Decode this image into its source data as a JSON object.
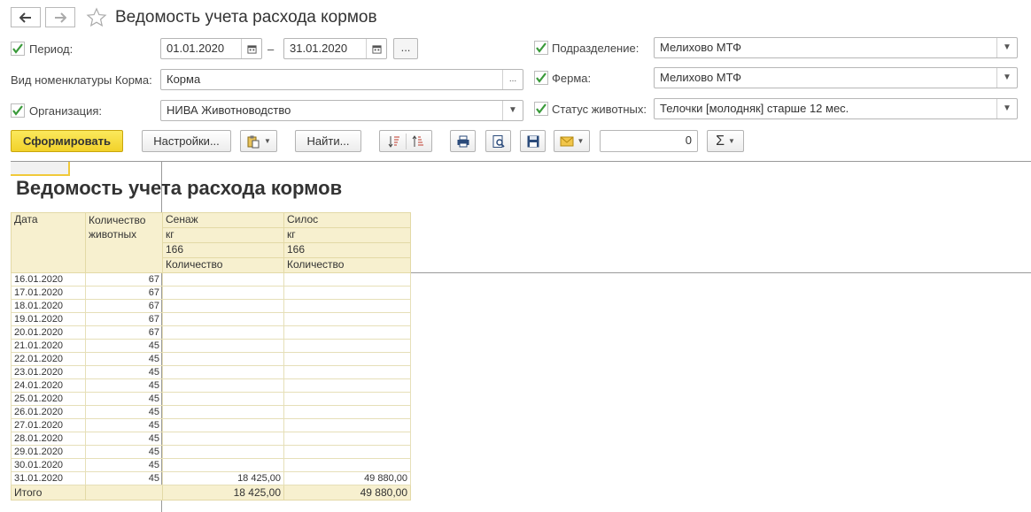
{
  "header": {
    "title": "Ведомость учета расхода кормов"
  },
  "form": {
    "period_label": "Период:",
    "period_from": "01.01.2020",
    "period_dash": "–",
    "period_to": "31.01.2020",
    "dots": "...",
    "nomenclature_label": "Вид номенклатуры Корма:",
    "nomenclature_value": "Корма",
    "org_label": "Организация:",
    "org_value": "НИВА Животноводство",
    "division_label": "Подразделение:",
    "division_value": "Мелихово МТФ",
    "farm_label": "Ферма:",
    "farm_value": "Мелихово МТФ",
    "status_label": "Статус животных:",
    "status_value": "Телочки [молодняк] старше 12 мес."
  },
  "toolbar": {
    "generate": "Сформировать",
    "settings": "Настройки...",
    "find": "Найти...",
    "amount_value": "0",
    "sum_symbol": "Σ"
  },
  "report": {
    "title": "Ведомость учета расхода кормов",
    "col_date": "Дата",
    "col_count": "Количество животных",
    "col_senazh": "Сенаж",
    "col_silos": "Силос",
    "unit_senazh": "кг",
    "unit_silos": "кг",
    "code_senazh": "166",
    "code_silos": "166",
    "qty_senazh": "Количество",
    "qty_silos": "Количество",
    "rows": [
      {
        "date": "16.01.2020",
        "count": "67",
        "senazh": "",
        "silos": ""
      },
      {
        "date": "17.01.2020",
        "count": "67",
        "senazh": "",
        "silos": ""
      },
      {
        "date": "18.01.2020",
        "count": "67",
        "senazh": "",
        "silos": ""
      },
      {
        "date": "19.01.2020",
        "count": "67",
        "senazh": "",
        "silos": ""
      },
      {
        "date": "20.01.2020",
        "count": "67",
        "senazh": "",
        "silos": ""
      },
      {
        "date": "21.01.2020",
        "count": "45",
        "senazh": "",
        "silos": ""
      },
      {
        "date": "22.01.2020",
        "count": "45",
        "senazh": "",
        "silos": ""
      },
      {
        "date": "23.01.2020",
        "count": "45",
        "senazh": "",
        "silos": ""
      },
      {
        "date": "24.01.2020",
        "count": "45",
        "senazh": "",
        "silos": ""
      },
      {
        "date": "25.01.2020",
        "count": "45",
        "senazh": "",
        "silos": ""
      },
      {
        "date": "26.01.2020",
        "count": "45",
        "senazh": "",
        "silos": ""
      },
      {
        "date": "27.01.2020",
        "count": "45",
        "senazh": "",
        "silos": ""
      },
      {
        "date": "28.01.2020",
        "count": "45",
        "senazh": "",
        "silos": ""
      },
      {
        "date": "29.01.2020",
        "count": "45",
        "senazh": "",
        "silos": ""
      },
      {
        "date": "30.01.2020",
        "count": "45",
        "senazh": "",
        "silos": ""
      },
      {
        "date": "31.01.2020",
        "count": "45",
        "senazh": "18 425,00",
        "silos": "49 880,00"
      }
    ],
    "total_label": "Итого",
    "total_senazh": "18 425,00",
    "total_silos": "49 880,00"
  },
  "colors": {
    "accent_yellow": "#f5dc3a",
    "check_green": "#3a9a3a",
    "header_cell": "#f7f0cf"
  },
  "icons": [
    "back-arrow-icon",
    "forward-arrow-icon",
    "star-icon",
    "calendar-icon",
    "checkbox-icon",
    "dropdown-icon",
    "clipboard-icon",
    "sort-desc-icon",
    "sort-asc-icon",
    "print-icon",
    "preview-icon",
    "save-icon",
    "mail-icon",
    "sum-icon"
  ]
}
